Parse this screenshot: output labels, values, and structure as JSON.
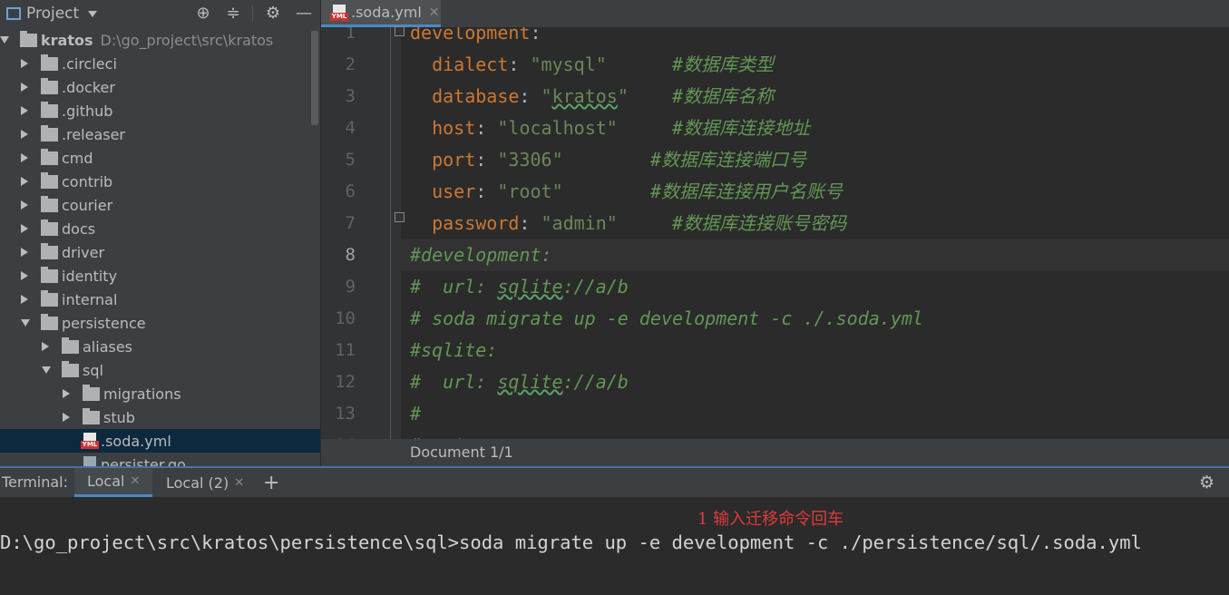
{
  "project": {
    "title": "Project",
    "tree": [
      {
        "label": "kratos",
        "path": "D:\\go_project\\src\\kratos",
        "depth": 0,
        "expanded": true,
        "type": "root"
      },
      {
        "label": ".circleci",
        "depth": 1,
        "expanded": false,
        "type": "folder"
      },
      {
        "label": ".docker",
        "depth": 1,
        "expanded": false,
        "type": "folder"
      },
      {
        "label": ".github",
        "depth": 1,
        "expanded": false,
        "type": "folder"
      },
      {
        "label": ".releaser",
        "depth": 1,
        "expanded": false,
        "type": "folder"
      },
      {
        "label": "cmd",
        "depth": 1,
        "expanded": false,
        "type": "folder"
      },
      {
        "label": "contrib",
        "depth": 1,
        "expanded": false,
        "type": "folder"
      },
      {
        "label": "courier",
        "depth": 1,
        "expanded": false,
        "type": "folder"
      },
      {
        "label": "docs",
        "depth": 1,
        "expanded": false,
        "type": "folder"
      },
      {
        "label": "driver",
        "depth": 1,
        "expanded": false,
        "type": "folder"
      },
      {
        "label": "identity",
        "depth": 1,
        "expanded": false,
        "type": "folder"
      },
      {
        "label": "internal",
        "depth": 1,
        "expanded": false,
        "type": "folder"
      },
      {
        "label": "persistence",
        "depth": 1,
        "expanded": true,
        "type": "folder"
      },
      {
        "label": "aliases",
        "depth": 2,
        "expanded": false,
        "type": "folder"
      },
      {
        "label": "sql",
        "depth": 2,
        "expanded": true,
        "type": "folder"
      },
      {
        "label": "migrations",
        "depth": 3,
        "expanded": false,
        "type": "folder"
      },
      {
        "label": "stub",
        "depth": 3,
        "expanded": false,
        "type": "folder"
      },
      {
        "label": ".soda.yml",
        "depth": 3,
        "type": "yml-file",
        "selected": true
      },
      {
        "label": "persister.go",
        "depth": 3,
        "type": "go-file"
      }
    ]
  },
  "editor": {
    "tab_label": ".soda.yml",
    "status": "Document 1/1",
    "current_line": 8,
    "lines": [
      {
        "num": "1",
        "key": "development",
        "colon": ":",
        "value": "",
        "comment": ""
      },
      {
        "num": "2",
        "indent": "  ",
        "key": "dialect",
        "colon": ": ",
        "value": "\"mysql\"",
        "pad": "      ",
        "comment": "#数据库类型"
      },
      {
        "num": "3",
        "indent": "  ",
        "key": "database",
        "colon": ": ",
        "value_open": "\"",
        "value_typo": "kratos",
        "value_close": "\"",
        "pad": "    ",
        "comment": "#数据库名称"
      },
      {
        "num": "4",
        "indent": "  ",
        "key": "host",
        "colon": ": ",
        "value": "\"localhost\"",
        "pad": "     ",
        "comment": "#数据库连接地址"
      },
      {
        "num": "5",
        "indent": "  ",
        "key": "port",
        "colon": ": ",
        "value": "\"3306\"",
        "pad": "        ",
        "comment": "#数据库连接端口号"
      },
      {
        "num": "6",
        "indent": "  ",
        "key": "user",
        "colon": ": ",
        "value": "\"root\"",
        "pad": "        ",
        "comment": "#数据库连接用户名账号"
      },
      {
        "num": "7",
        "indent": "  ",
        "key": "password",
        "colon": ": ",
        "value": "\"admin\"",
        "pad": "     ",
        "comment": "#数据库连接账号密码"
      },
      {
        "num": "8",
        "comment_full": "#development:"
      },
      {
        "num": "9",
        "comment_pre": "#  url: ",
        "comment_typo": "sqlite",
        "comment_post": "://a/b"
      },
      {
        "num": "10",
        "comment_full": "# soda migrate up -e development -c ./.soda.yml"
      },
      {
        "num": "11",
        "comment_full": "#sqlite:"
      },
      {
        "num": "12",
        "comment_pre": "#  url: ",
        "comment_typo": "sqlite",
        "comment_post": "://a/b"
      },
      {
        "num": "13",
        "comment_full": "#"
      },
      {
        "num": "14",
        "comment_full": "#postgres:"
      }
    ]
  },
  "terminal": {
    "label": "Terminal:",
    "tabs": [
      "Local",
      "Local (2)"
    ],
    "annotation": "1 输入迁移命令回车",
    "command_line": "D:\\go_project\\src\\kratos\\persistence\\sql>soda migrate up -e development -c ./persistence/sql/.soda.yml"
  },
  "icons": {
    "project": "project-window-icon",
    "locate": "crosshair-icon",
    "collapse": "collapse-all-icon",
    "settings": "gear-icon",
    "hide": "minimize-icon",
    "add": "plus-icon"
  }
}
